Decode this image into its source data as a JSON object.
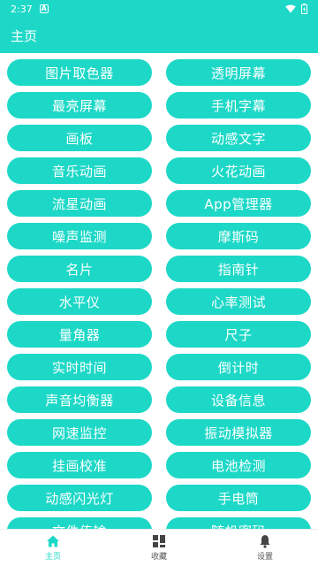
{
  "status_bar": {
    "time": "2:37",
    "notification_badge": "A"
  },
  "app_bar": {
    "title": "主页"
  },
  "colors": {
    "accent": "#1dd8c7",
    "tile_text": "#ffffff",
    "nav_inactive": "#555555"
  },
  "tiles": [
    {
      "label": "图片取色器"
    },
    {
      "label": "透明屏幕"
    },
    {
      "label": "最亮屏幕"
    },
    {
      "label": "手机字幕"
    },
    {
      "label": "画板"
    },
    {
      "label": "动感文字"
    },
    {
      "label": "音乐动画"
    },
    {
      "label": "火花动画"
    },
    {
      "label": "流星动画"
    },
    {
      "label": "App管理器"
    },
    {
      "label": "噪声监测"
    },
    {
      "label": "摩斯码"
    },
    {
      "label": "名片"
    },
    {
      "label": "指南针"
    },
    {
      "label": "水平仪"
    },
    {
      "label": "心率测试"
    },
    {
      "label": "量角器"
    },
    {
      "label": "尺子"
    },
    {
      "label": "实时时间"
    },
    {
      "label": "倒计时"
    },
    {
      "label": "声音均衡器"
    },
    {
      "label": "设备信息"
    },
    {
      "label": "网速监控"
    },
    {
      "label": "振动模拟器"
    },
    {
      "label": "挂画校准"
    },
    {
      "label": "电池检测"
    },
    {
      "label": "动感闪光灯"
    },
    {
      "label": "手电筒"
    },
    {
      "label": "文件传输"
    },
    {
      "label": "随机密码"
    }
  ],
  "bottom_nav": {
    "items": [
      {
        "label": "主页",
        "icon": "home-icon",
        "active": true
      },
      {
        "label": "收藏",
        "icon": "grid-icon",
        "active": false
      },
      {
        "label": "设置",
        "icon": "bell-icon",
        "active": false
      }
    ]
  }
}
